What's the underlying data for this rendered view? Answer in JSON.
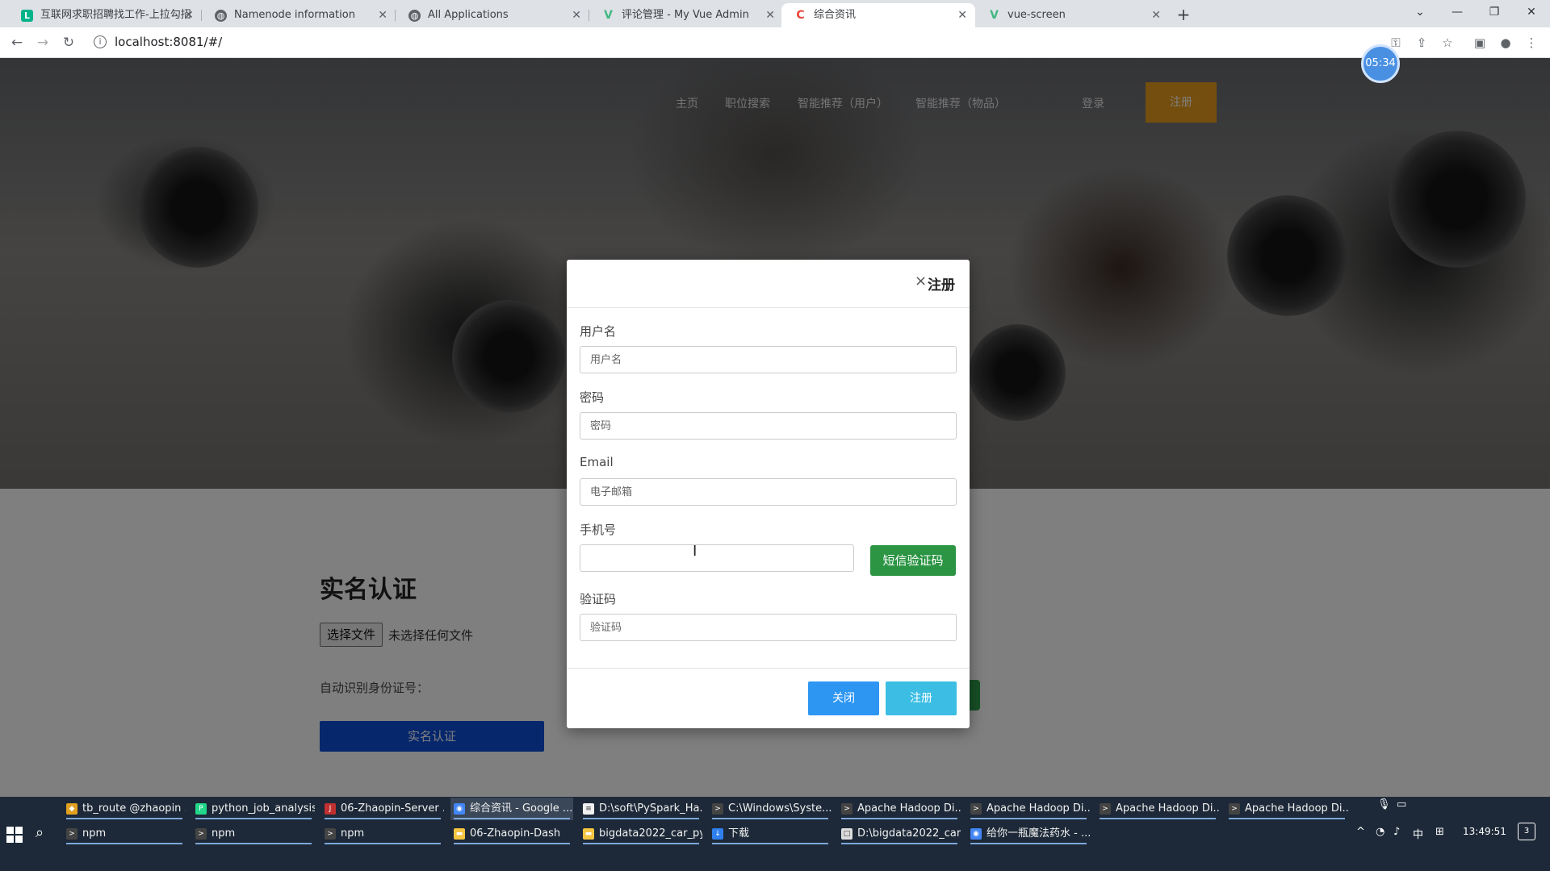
{
  "browser": {
    "tabs": [
      {
        "title": "互联网求职招聘找工作-上拉勾招",
        "icon": "lagou-icon",
        "color": "#00b38a"
      },
      {
        "title": "Namenode information",
        "icon": "globe-icon",
        "color": "#5f6368"
      },
      {
        "title": "All Applications",
        "icon": "globe-icon",
        "color": "#5f6368"
      },
      {
        "title": "评论管理 - My Vue Admin",
        "icon": "vue-icon",
        "color": "#41b883"
      },
      {
        "title": "综合资讯",
        "icon": "loading-icon",
        "color": "#e8453c"
      },
      {
        "title": "vue-screen",
        "icon": "vue-icon",
        "color": "#41b883"
      }
    ],
    "url": "localhost:8081/#/",
    "timer": "05:34"
  },
  "nav": {
    "home": "主页",
    "job_search": "职位搜索",
    "rec_user": "智能推荐（用户）",
    "rec_item": "智能推荐（物品）",
    "login": "登录",
    "register": "注册"
  },
  "realname": {
    "title": "实名认证",
    "file_button": "选择文件",
    "file_status": "未选择任何文件",
    "id_label": "自动识别身份证号：",
    "submit": "实名认证"
  },
  "modal": {
    "close_icon": "×",
    "title": "注册",
    "username_label": "用户名",
    "username_placeholder": "用户名",
    "password_label": "密码",
    "password_placeholder": "密码",
    "email_label": "Email",
    "email_placeholder": "电子邮箱",
    "phone_label": "手机号",
    "phone_placeholder": "",
    "sms_button": "短信验证码",
    "code_label": "验证码",
    "code_placeholder": "验证码",
    "close_button": "关闭",
    "register_button": "注册"
  },
  "taskbar": {
    "row1": [
      {
        "label": "tb_route @zhaopin ...",
        "icon": "db-icon"
      },
      {
        "label": "python_job_analysis...",
        "icon": "pycharm-icon"
      },
      {
        "label": "06-Zhaopin-Server ...",
        "icon": "ide-icon"
      },
      {
        "label": "综合资讯 - Google ...",
        "icon": "chrome-icon"
      },
      {
        "label": "D:\\soft\\PySpark_Ha...",
        "icon": "notepad-icon"
      },
      {
        "label": "C:\\Windows\\Syste...",
        "icon": "cmd-icon"
      },
      {
        "label": "Apache Hadoop Di...",
        "icon": "cmd-icon"
      },
      {
        "label": "Apache Hadoop Di...",
        "icon": "cmd-icon"
      },
      {
        "label": "Apache Hadoop Di...",
        "icon": "cmd-icon"
      },
      {
        "label": "Apache Hadoop Di...",
        "icon": "cmd-icon"
      }
    ],
    "row2": [
      {
        "label": "npm",
        "icon": "cmd-icon"
      },
      {
        "label": "npm",
        "icon": "cmd-icon"
      },
      {
        "label": "npm",
        "icon": "cmd-icon"
      },
      {
        "label": "06-Zhaopin-Dash",
        "icon": "folder-icon"
      },
      {
        "label": "bigdata2022_car_py...",
        "icon": "folder-icon"
      },
      {
        "label": "下载",
        "icon": "download-icon"
      },
      {
        "label": "D:\\bigdata2022_car...",
        "icon": "window-icon"
      },
      {
        "label": "给你一瓶魔法药水 - ...",
        "icon": "chrome-icon"
      }
    ],
    "ime": "中",
    "time": "13:49:51",
    "notifications": "3"
  }
}
